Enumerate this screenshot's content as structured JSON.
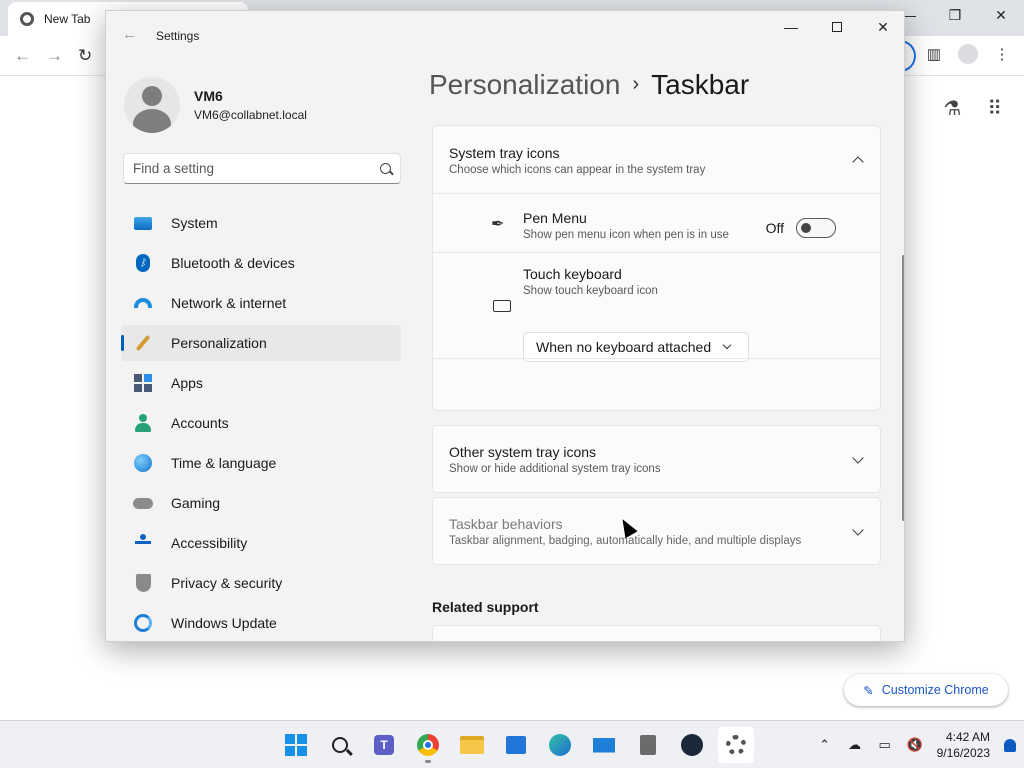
{
  "chrome": {
    "tab_title": "New Tab",
    "customize_label": "Customize Chrome"
  },
  "settings": {
    "window_title": "Settings",
    "user": {
      "name": "VM6",
      "email": "VM6@collabnet.local"
    },
    "search_placeholder": "Find a setting",
    "nav": [
      {
        "label": "System",
        "icon": "system-icon"
      },
      {
        "label": "Bluetooth & devices",
        "icon": "bluetooth-icon"
      },
      {
        "label": "Network & internet",
        "icon": "wifi-icon"
      },
      {
        "label": "Personalization",
        "icon": "brush-icon",
        "active": true
      },
      {
        "label": "Apps",
        "icon": "apps-icon"
      },
      {
        "label": "Accounts",
        "icon": "person-icon"
      },
      {
        "label": "Time & language",
        "icon": "globe-clock-icon"
      },
      {
        "label": "Gaming",
        "icon": "gamepad-icon"
      },
      {
        "label": "Accessibility",
        "icon": "accessibility-icon"
      },
      {
        "label": "Privacy & security",
        "icon": "shield-icon"
      },
      {
        "label": "Windows Update",
        "icon": "update-icon"
      }
    ],
    "breadcrumb": {
      "parent": "Personalization",
      "separator": "›",
      "current": "Taskbar"
    },
    "system_tray": {
      "title": "System tray icons",
      "subtitle": "Choose which icons can appear in the system tray",
      "pen_menu": {
        "title": "Pen Menu",
        "subtitle": "Show pen menu icon when pen is in use",
        "state_label": "Off"
      },
      "touch_keyboard": {
        "title": "Touch keyboard",
        "subtitle": "Show touch keyboard icon",
        "selected": "When no keyboard attached"
      }
    },
    "other_tray": {
      "title": "Other system tray icons",
      "subtitle": "Show or hide additional system tray icons"
    },
    "behaviors": {
      "title": "Taskbar behaviors",
      "subtitle": "Taskbar alignment, badging, automatically hide, and multiple displays"
    },
    "related_support": "Related support"
  },
  "taskbar": {
    "time": "4:42 AM",
    "date": "9/16/2023",
    "accent": "#005fb8"
  }
}
